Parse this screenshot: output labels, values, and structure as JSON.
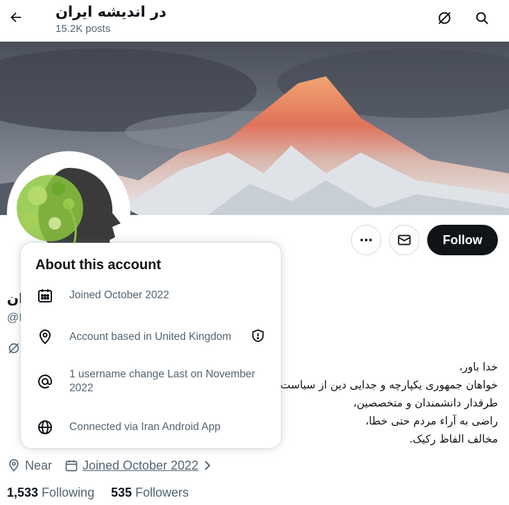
{
  "header": {
    "title": "در اندیشه ایران",
    "posts": "15.2K posts",
    "back_icon": "arrow-left-icon",
    "grok_icon": "grok-icon",
    "search_icon": "search-icon"
  },
  "profile": {
    "name_fragment": "ران",
    "handle_fragment": "@I",
    "follow_label": "Follow",
    "more_icon": "more-icon",
    "message_icon": "envelope-icon",
    "bio": [
      "خدا باور،",
      "خواهان جمهوری یکپارچه و جدایی دین از سیاست،",
      "طرفدار دانشمندان و متخصصین،",
      "راضی به آراء مردم حتی خطا،",
      "مخالف الفاظ رکیک."
    ],
    "location": "Near",
    "joined": "Joined October 2022",
    "following_count": "1,533",
    "following_label": "Following",
    "followers_count": "535",
    "followers_label": "Followers"
  },
  "about_popup": {
    "title": "About this account",
    "rows": [
      {
        "icon": "calendar-icon",
        "text": "Joined October 2022"
      },
      {
        "icon": "location-pin-icon",
        "text": "Account based in United Kingdom"
      },
      {
        "icon": "at-sign-icon",
        "text": "1 username change Last on November 2022"
      },
      {
        "icon": "globe-icon",
        "text": "Connected via Iran Android App"
      }
    ]
  },
  "colors": {
    "primary_text": "#0f1419",
    "secondary_text": "#536471",
    "border": "#cfd9de",
    "follow_bg": "#0f1419"
  }
}
